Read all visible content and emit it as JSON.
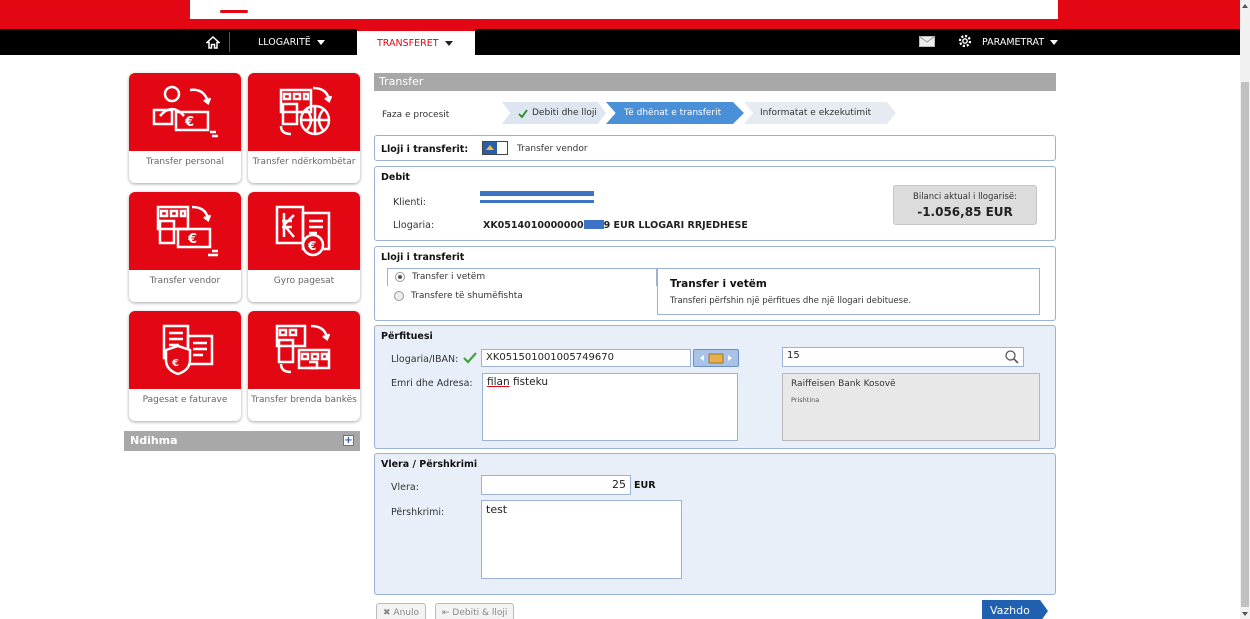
{
  "nav": {
    "accounts_label": "LLOGARITË",
    "transfers_label": "TRANSFERET",
    "params_label": "PARAMETRAT"
  },
  "sidebar": {
    "tiles": [
      {
        "label": "Transfer personal"
      },
      {
        "label": "Transfer ndërkombëtar"
      },
      {
        "label": "Transfer vendor"
      },
      {
        "label": "Gyro pagesat"
      },
      {
        "label": "Pagesat e faturave"
      },
      {
        "label": "Transfer brenda bankës"
      }
    ],
    "help_label": "Ndihma"
  },
  "panel": {
    "title": "Transfer",
    "steps_label": "Faza e procesit",
    "steps": [
      "Debiti dhe lloji",
      "Të dhënat e transferit",
      "Informatat e ekzekutimit"
    ]
  },
  "transfer_type": {
    "label": "Lloji i transferit:",
    "value": "Transfer vendor"
  },
  "debit": {
    "title": "Debit",
    "client_label": "Klienti:",
    "account_label": "Llogaria:",
    "account_prefix": "XK0514010000000",
    "account_suffix": "9 EUR LLOGARI RRJEDHESE",
    "balance_label": "Bilanci aktual i llogarisë:",
    "balance_value": "-1.056,85 EUR"
  },
  "transfer_kind": {
    "title": "Lloji i transferit",
    "option_single": "Transfer i vetëm",
    "option_multiple": "Transfere të shumëfishta",
    "info_title": "Transfer i vetëm",
    "info_text": "Transferi përfshin një përfitues dhe një llogari debituese."
  },
  "beneficiary": {
    "title": "Përfituesi",
    "iban_label": "Llogaria/IBAN:",
    "iban_value": "XK051501001005749670",
    "search_value": "15",
    "name_label": "Emri dhe Adresa:",
    "name_value_word1": "filan",
    "name_value_word2": "fisteku",
    "bank_name": "Raiffeisen Bank Kosovë",
    "bank_city": "Prishtina"
  },
  "amount": {
    "title": "Vlera / Përshkrimi",
    "value_label": "Vlera:",
    "value": "25",
    "currency": "EUR",
    "desc_label": "Përshkrimi:",
    "desc_value": "test"
  },
  "buttons": {
    "cancel": "Anulo",
    "back": "Debiti & lloji",
    "next": "Vazhdo"
  },
  "colors": {
    "brand_red": "#e30613",
    "step_active": "#4a90d9",
    "next_button": "#2060b0"
  }
}
